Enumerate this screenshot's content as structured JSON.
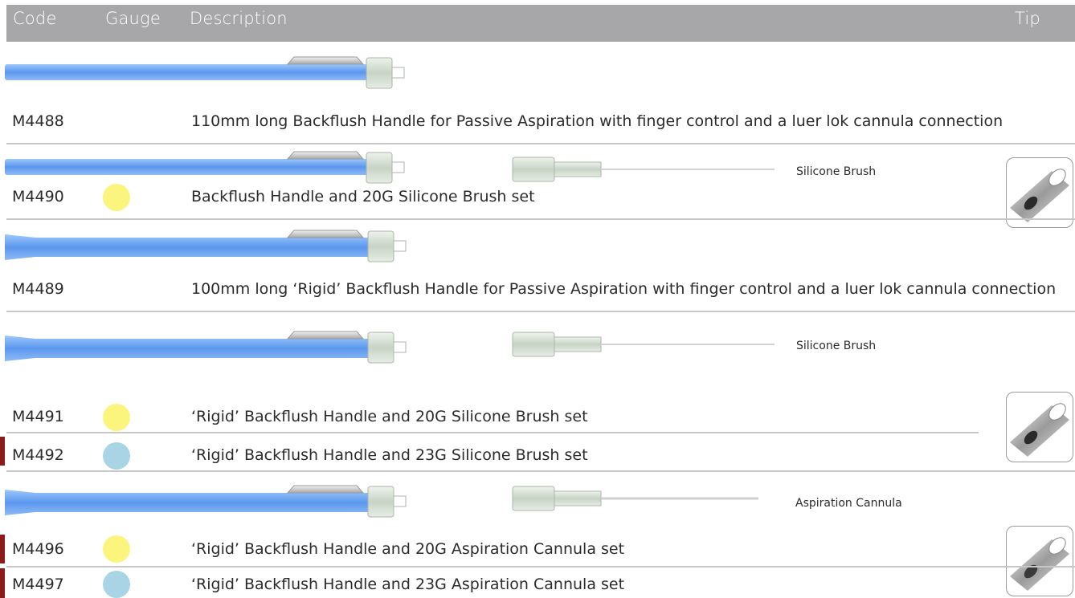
{
  "header": {
    "code": "Code",
    "gauge": "Gauge",
    "description": "Description",
    "tip": "Tip"
  },
  "rows": [
    {
      "code": "M4488",
      "description": "110mm long Backflush Handle for Passive Aspiration with finger control and a luer lok cannula connection"
    },
    {
      "code": "M4490",
      "gauge_color": "#fbf57e",
      "description": "Backflush Handle and 20G Silicone Brush set",
      "attachment_label": "Silicone Brush"
    },
    {
      "code": "M4489",
      "description": "100mm long ‘Rigid’ Backflush Handle for Passive Aspiration with finger control and a luer lok cannula connection"
    },
    {
      "code": "M4491",
      "gauge_color": "#fbf57e",
      "description": "‘Rigid’ Backflush Handle and 20G Silicone Brush set",
      "attachment_label": "Silicone Brush"
    },
    {
      "code": "M4492",
      "gauge_color": "#a9d4e6",
      "description": "‘Rigid’ Backflush Handle and 23G Silicone Brush set"
    },
    {
      "code": "M4496",
      "gauge_color": "#fbf57e",
      "description": "‘Rigid’ Backflush Handle and 20G Aspiration Cannula set",
      "attachment_label": "Aspiration Cannula"
    },
    {
      "code": "M4497",
      "gauge_color": "#a9d4e6",
      "description": "‘Rigid’ Backflush Handle and 23G Aspiration Cannula set"
    }
  ],
  "colors": {
    "header_bg": "#a7a7a9",
    "handle_blue": "#6fa7f0",
    "marker": "#8b1a1a",
    "divider": "#c8c8c8"
  },
  "icons": {
    "handle": "backflush-handle-icon",
    "brush": "silicone-brush-icon",
    "cannula": "aspiration-cannula-icon",
    "tip": "tip-icon"
  }
}
